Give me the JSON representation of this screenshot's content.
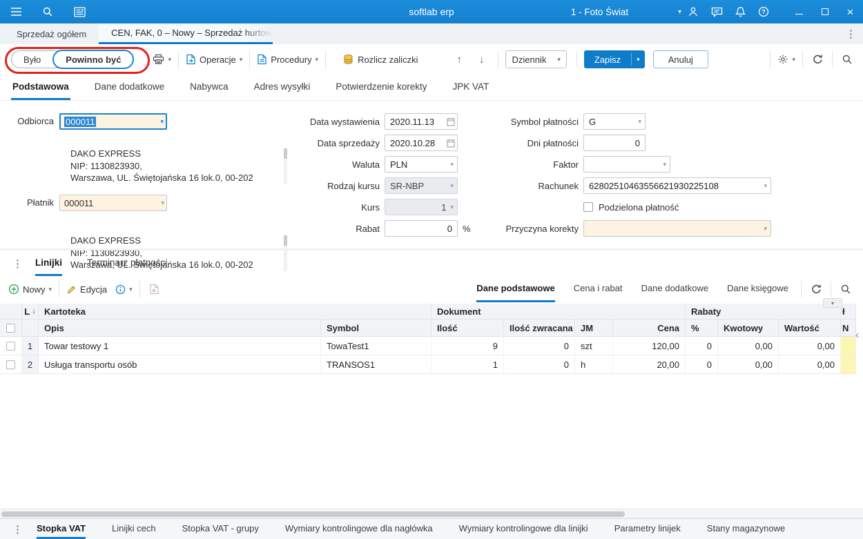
{
  "titlebar": {
    "app_title": "softlab erp",
    "company": "1 - Foto Świat"
  },
  "doc_tabs": {
    "inactive": "Sprzedaż ogółem",
    "active": "CEN, FAK, 0 – Nowy – Sprzedaż hurtow"
  },
  "toolbar": {
    "bylo": "Było",
    "powinno_byc": "Powinno być",
    "operacje": "Operacje",
    "procedury": "Procedury",
    "rozlicz_zaliczki": "Rozlicz zaliczki",
    "dziennik": "Dziennik",
    "zapisz": "Zapisz",
    "anuluj": "Anuluj"
  },
  "form_tabs": [
    "Podstawowa",
    "Dane dodatkowe",
    "Nabywca",
    "Adres wysyłki",
    "Potwierdzenie korekty",
    "JPK VAT"
  ],
  "form": {
    "odbiorca": {
      "label": "Odbiorca",
      "value": "000011",
      "address_line1": "DAKO EXPRESS",
      "address_line2": "NIP: 1130823930,",
      "address_line3": "Warszawa, UL. Świętojańska 16 lok.0, 00-202"
    },
    "platnik": {
      "label": "Płatnik",
      "value": "000011",
      "address_line1": "DAKO EXPRESS",
      "address_line2": "NIP: 1130823930,",
      "address_line3": "Warszawa, UL. Świętojańska 16 lok.0, 00-202"
    },
    "data_wystawienia": {
      "label": "Data wystawienia",
      "value": "2020.11.13"
    },
    "data_sprzedazy": {
      "label": "Data sprzedaży",
      "value": "2020.10.28"
    },
    "waluta": {
      "label": "Waluta",
      "value": "PLN"
    },
    "rodzaj_kursu": {
      "label": "Rodzaj kursu",
      "value": "SR-NBP"
    },
    "kurs": {
      "label": "Kurs",
      "value": "1"
    },
    "rabat": {
      "label": "Rabat",
      "value": "0",
      "suffix": "%"
    },
    "symbol_platnosci": {
      "label": "Symbol płatności",
      "value": "G"
    },
    "dni_platnosci": {
      "label": "Dni płatności",
      "value": "0"
    },
    "faktor": {
      "label": "Faktor",
      "value": ""
    },
    "rachunek": {
      "label": "Rachunek",
      "value": "62802510463556621930225108"
    },
    "podzielona_platnosc": {
      "label": "Podzielona płatność",
      "checked": false
    },
    "przyczyna_korekty": {
      "label": "Przyczyna korekty",
      "value": ""
    }
  },
  "lower_tabs": [
    "Linijki",
    "Terminarz płatności"
  ],
  "grid_toolbar": {
    "nowy": "Nowy",
    "edycja": "Edycja",
    "view_tabs": [
      "Dane podstawowe",
      "Cena i rabat",
      "Dane dodatkowe",
      "Dane księgowe"
    ]
  },
  "table": {
    "sort_col": "L",
    "groups": [
      "Kartoteka",
      "Dokument",
      "Rabaty",
      "ł"
    ],
    "columns": [
      "Opis",
      "Symbol",
      "Ilość",
      "Ilość zwracana",
      "JM",
      "Cena",
      "%",
      "Kwotowy",
      "Wartość",
      "N"
    ],
    "rows": [
      {
        "num": "1",
        "opis": "Towar testowy 1",
        "symbol": "TowaTest1",
        "ilosc": "9",
        "ilosc_zwracana": "0",
        "jm": "szt",
        "cena": "120,00",
        "rabat_pct": "0",
        "rabat_kwotowy": "0,00",
        "rabat_wartosc": "0,00"
      },
      {
        "num": "2",
        "opis": "Usługa transportu osób",
        "symbol": "TRANSOS1",
        "ilosc": "1",
        "ilosc_zwracana": "0",
        "jm": "h",
        "cena": "20,00",
        "rabat_pct": "0",
        "rabat_kwotowy": "0,00",
        "rabat_wartosc": "0,00"
      }
    ]
  },
  "bottom_tabs": [
    "Stopka VAT",
    "Linijki cech",
    "Stopka VAT - grupy",
    "Wymiary kontrolingowe dla nagłówka",
    "Wymiary kontrolingowe dla linijki",
    "Parametry linijek",
    "Stany magazynowe"
  ],
  "icons": {
    "menu": "hamburger",
    "search": "magnifier",
    "news": "newspaper",
    "user": "person",
    "chat": "speech-bubble",
    "notifications": "bell",
    "help": "question-circle",
    "minimize": "–",
    "maximize": "□",
    "close": "×",
    "print": "printer",
    "operations": "document-arrow",
    "procedures": "document-arrow",
    "advances": "coins",
    "settings": "gear",
    "refresh": "circular-arrows",
    "new": "plus-circle",
    "edit": "pencil",
    "delete": "document-x",
    "more_vertical": "⋮",
    "chevron_down": "▾",
    "arrow_up": "↑",
    "arrow_down": "↓",
    "sort_desc": "↓",
    "scroll_left": "‹"
  },
  "colors": {
    "primary_blue": "#1585d5",
    "accent_underline": "#1079c8",
    "field_yellow": "#fdf3e0",
    "field_disabled": "#e9ebee",
    "row_highlight_yellow": "#fbf7b3",
    "annotation_red": "#e3211a",
    "selection_blue": "#2e87d4"
  }
}
